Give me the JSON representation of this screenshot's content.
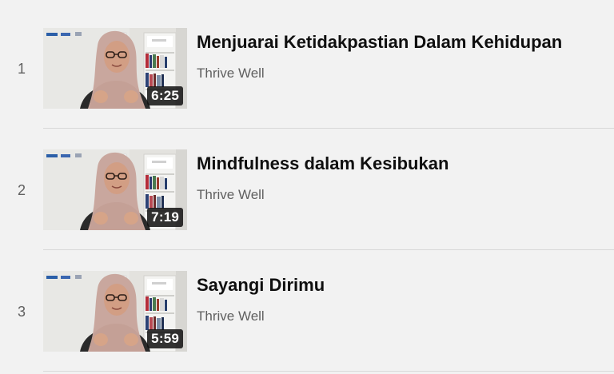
{
  "playlist": {
    "items": [
      {
        "index": "1",
        "title": "Menjuarai Ketidakpastian Dalam Kehidupan",
        "channel": "Thrive Well",
        "duration": "6:25"
      },
      {
        "index": "2",
        "title": "Mindfulness dalam Kesibukan",
        "channel": "Thrive Well",
        "duration": "7:19"
      },
      {
        "index": "3",
        "title": "Sayangi Dirimu",
        "channel": "Thrive Well",
        "duration": "5:59"
      }
    ]
  },
  "colors": {
    "background": "#f2f2f2",
    "title": "#0f0f0f",
    "secondary_text": "#606060",
    "divider": "#d8d8d8",
    "hijab": "#c9a79e",
    "duration_badge": "#121212"
  },
  "thumbnail_description_icons": [
    "presenter-thumbnail"
  ]
}
